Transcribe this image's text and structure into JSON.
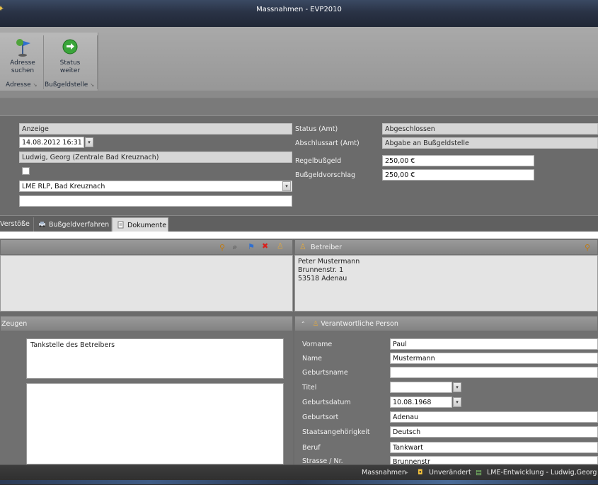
{
  "window": {
    "title": "Massnahmen - EVP2010"
  },
  "ribbon": {
    "buttons": [
      {
        "label1": "Adresse",
        "label2": "suchen",
        "icon": "pin-flag-icon"
      },
      {
        "label1": "Status",
        "label2": "weiter",
        "icon": "green-arrow-icon"
      }
    ],
    "groups": [
      "Adresse",
      "Bußgeldstelle"
    ]
  },
  "form": {
    "anzeige": "Anzeige",
    "datum": "14.08.2012 16:31",
    "person": "Ludwig, Georg (Zentrale Bad Kreuznach)",
    "stelle": "LME RLP, Bad Kreuznach",
    "extra": "",
    "status_amt_label": "Status (Amt)",
    "status_amt_value": "Abgeschlossen",
    "abschlussart_label": "Abschlussart (Amt)",
    "abschlussart_value": "Abgabe an Bußgeldstelle",
    "regelbussgeld_label": "Regelbußgeld",
    "regelbussgeld_value": "250,00 €",
    "bussgeldvorschlag_label": "Bußgeldvorschlag",
    "bussgeldvorschlag_value": "250,00 €"
  },
  "tabs": [
    {
      "label": "Verstöße",
      "icon": ""
    },
    {
      "label": "Bußgeldverfahren",
      "icon": "car-icon"
    },
    {
      "label": "Dokumente",
      "icon": "document-icon"
    }
  ],
  "betreiber": {
    "title": "Betreiber",
    "line1": "Peter Mustermann",
    "line2": "Brunnenstr. 1",
    "line3": "53518 Adenau"
  },
  "zeugen": {
    "title": "Zeugen",
    "ort": "Tankstelle des Betreibers"
  },
  "verantwortlich": {
    "title": "Verantwortliche Person",
    "fields": [
      {
        "label": "Vorname",
        "value": "Paul"
      },
      {
        "label": "Name",
        "value": "Mustermann"
      },
      {
        "label": "Geburtsname",
        "value": ""
      },
      {
        "label": "Titel",
        "value": ""
      },
      {
        "label": "Geburtsdatum",
        "value": "10.08.1968"
      },
      {
        "label": "Geburtsort",
        "value": "Adenau"
      },
      {
        "label": "Staatsangehörigkeit",
        "value": "Deutsch"
      },
      {
        "label": "Beruf",
        "value": "Tankwart"
      },
      {
        "label": "Strasse / Nr.",
        "value": "Brunnenstr"
      }
    ]
  },
  "statusbar": {
    "module": "Massnahmen",
    "state": "Unverändert",
    "user": "LME-Entwicklung - Ludwig,Georg"
  }
}
